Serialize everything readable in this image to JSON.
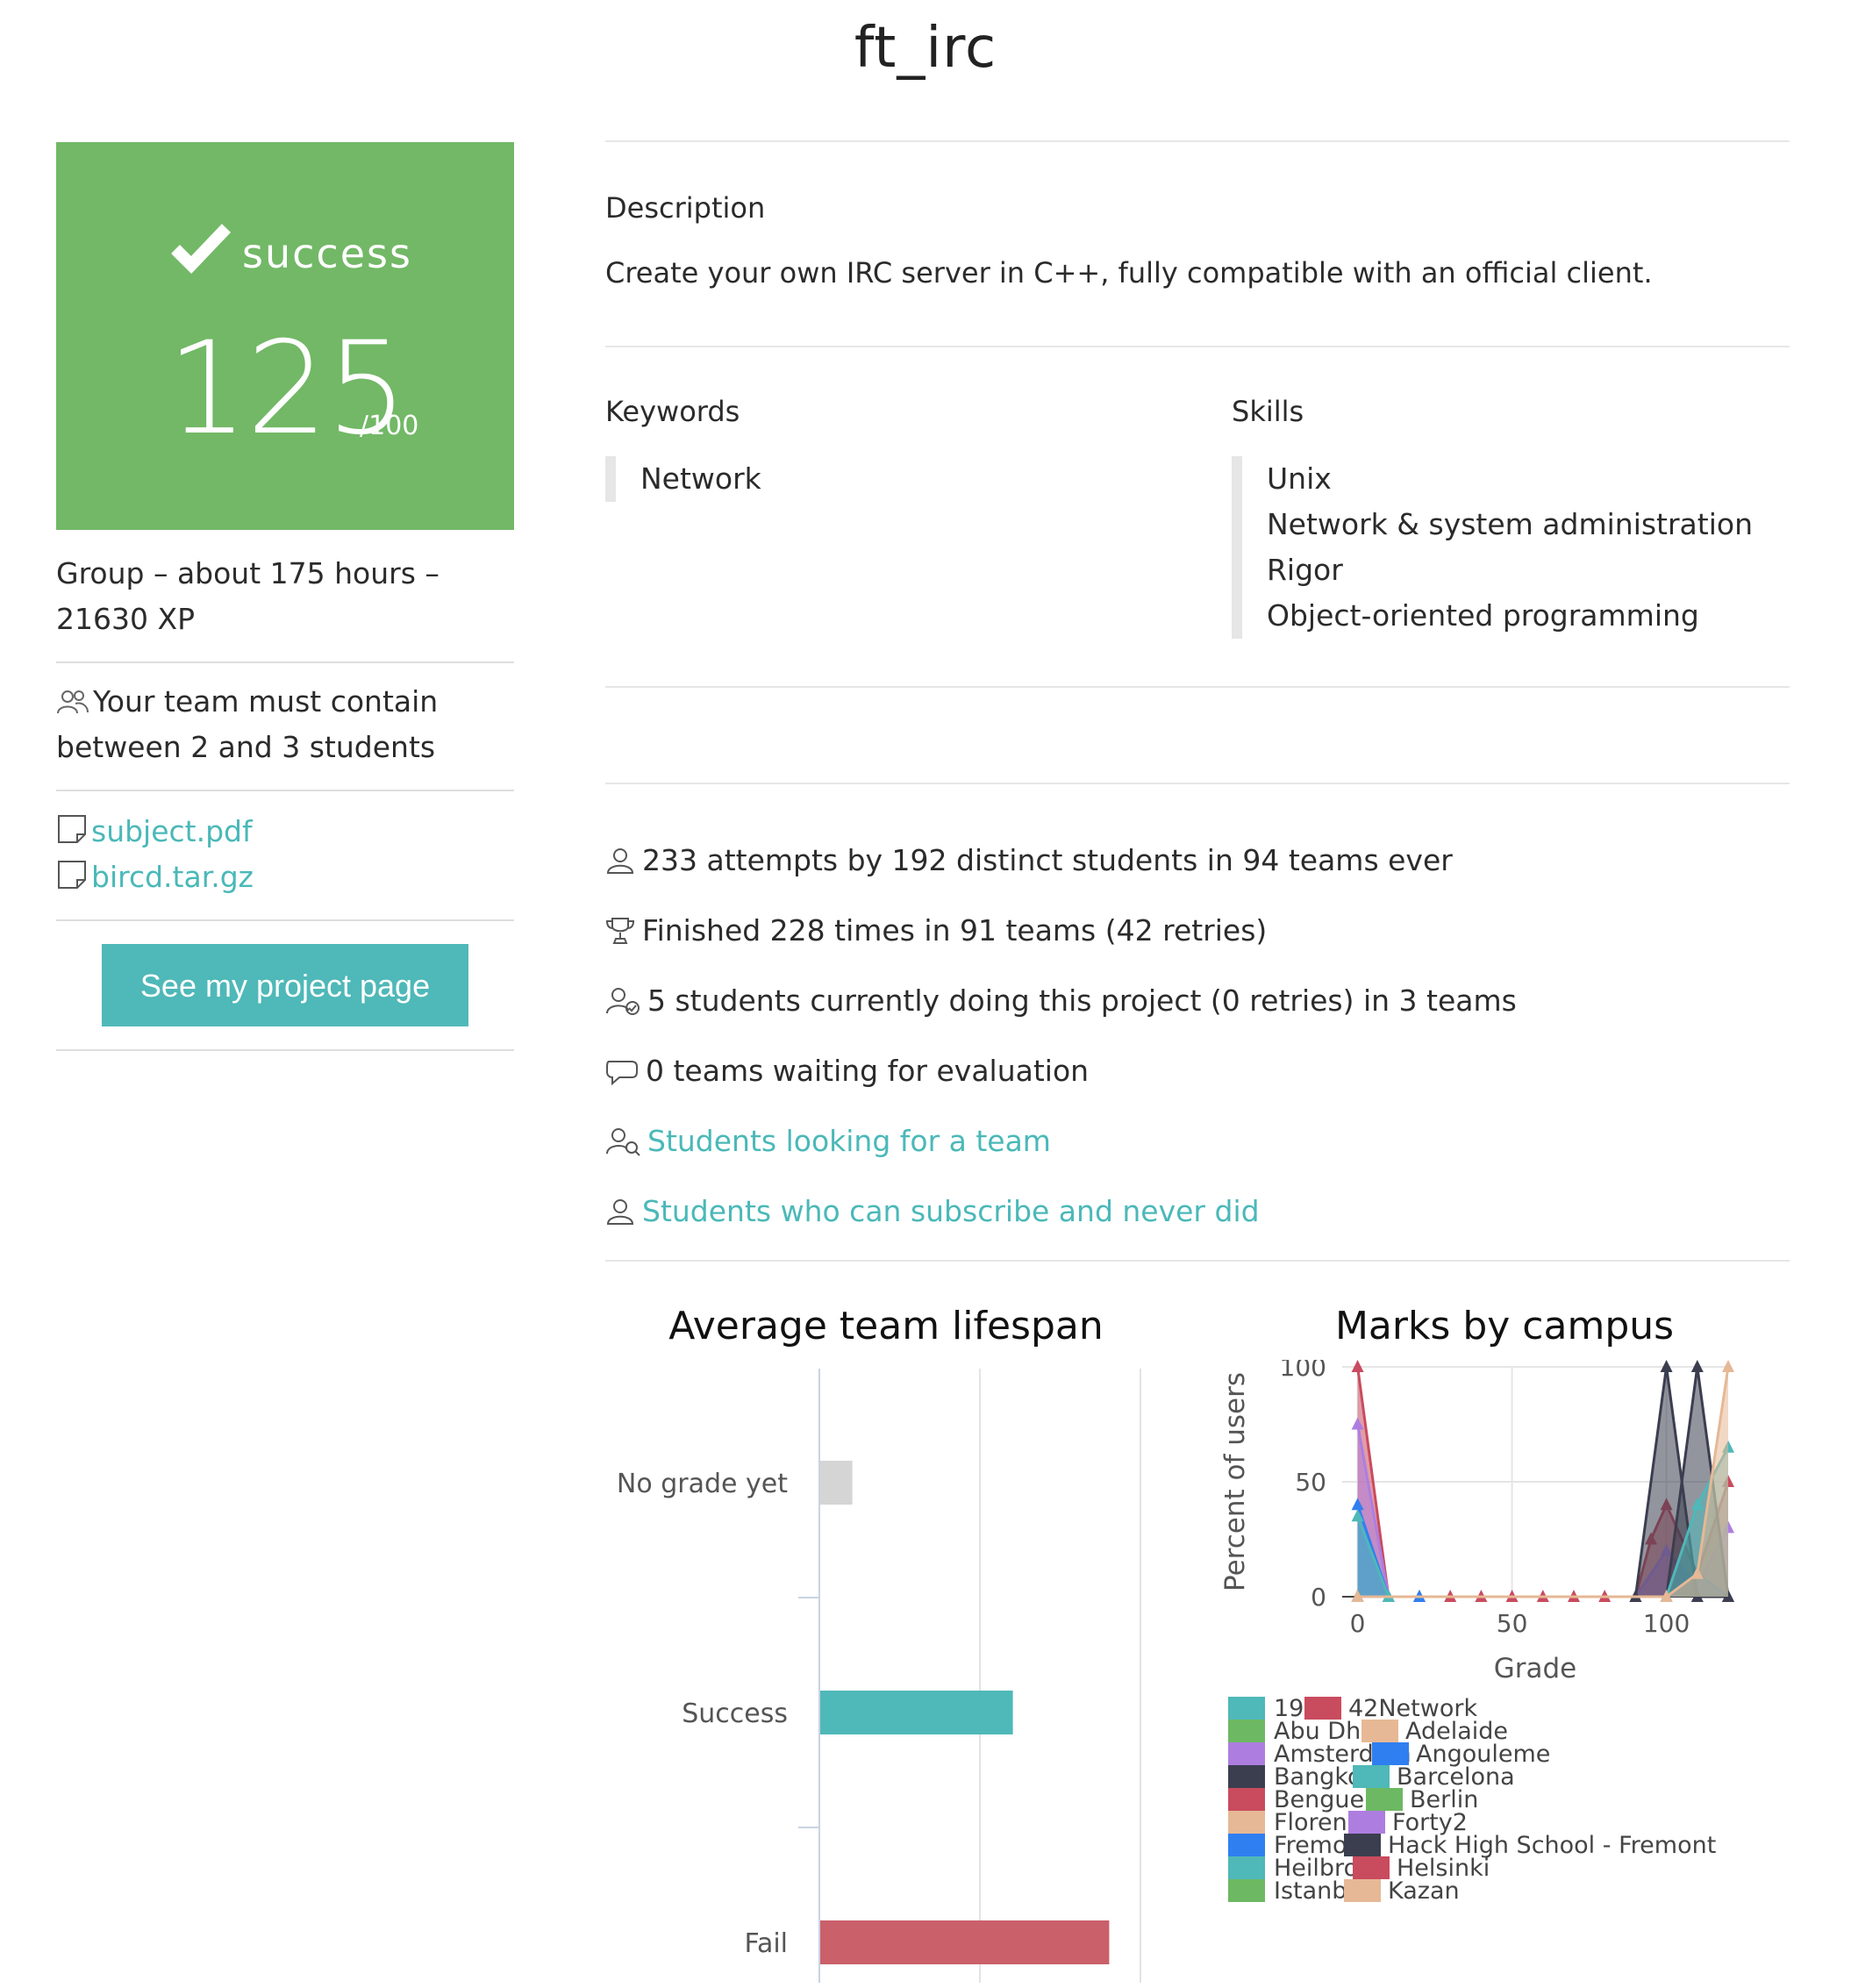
{
  "page": {
    "title": "ft_irc"
  },
  "mark": {
    "status": "success",
    "value": "125",
    "out_of": "/100"
  },
  "meta": {
    "info": "Group – about 175 hours – 21630 XP",
    "team_size": "Your team must contain between 2 and 3 students"
  },
  "attachments": [
    {
      "name": "subject.pdf"
    },
    {
      "name": "bircd.tar.gz"
    }
  ],
  "project_button": {
    "label": "See my project page"
  },
  "description": {
    "label": "Description",
    "text": "Create your own IRC server in C++, fully compatible with an official client."
  },
  "keywords": {
    "label": "Keywords",
    "items": [
      "Network"
    ]
  },
  "skills": {
    "label": "Skills",
    "items": [
      "Unix",
      "Network & system administration",
      "Rigor",
      "Object-oriented programming"
    ]
  },
  "stats": {
    "attempts": "233 attempts by 192 distinct students in 94 teams ever",
    "finished": "Finished 228 times in 91 teams (42 retries)",
    "current": "5 students currently doing this project (0 retries) in 3 teams",
    "waiting": "0 teams waiting for evaluation",
    "looking_link": "Students looking for a team",
    "never_link": "Students who can subscribe and never did"
  },
  "colors": {
    "success": "#72b866",
    "accent": "#4fb8b8",
    "fail": "#c9606a",
    "no_grade": "#d5d5d5"
  },
  "icons": [
    "check-icon",
    "team-icon",
    "file-icon",
    "user-icon",
    "trophy-icon",
    "user-check-icon",
    "chat-icon",
    "user-search-icon"
  ],
  "chart_data": [
    {
      "type": "bar",
      "title": "Average team lifespan",
      "orientation": "horizontal",
      "categories": [
        "No grade yet",
        "Success",
        "Fail"
      ],
      "values": [
        5,
        30,
        45
      ],
      "xlim": [
        0,
        50
      ],
      "grid": true,
      "colors": [
        "#d5d5d5",
        "#4fb8b8",
        "#c9606a"
      ]
    },
    {
      "type": "area",
      "title": "Marks by campus",
      "xlabel": "Grade",
      "ylabel": "Percent of users",
      "xlim": [
        -5,
        120
      ],
      "ylim": [
        0,
        100
      ],
      "xticks": [
        0,
        50,
        100
      ],
      "yticks": [
        0,
        50,
        100
      ],
      "grid": true,
      "legend_position": "bottom",
      "legend": [
        {
          "name": "19",
          "color": "#4fb8b8"
        },
        {
          "name": "42Network",
          "color": "#c94b5e"
        },
        {
          "name": "Abu Dhabi",
          "color": "#6db862"
        },
        {
          "name": "Adelaide",
          "color": "#e6b895"
        },
        {
          "name": "Amsterdam",
          "color": "#ad7ee0"
        },
        {
          "name": "Angouleme",
          "color": "#2f7ff0"
        },
        {
          "name": "Bangkok",
          "color": "#3b3e4f"
        },
        {
          "name": "Barcelona",
          "color": "#4fb8b8"
        },
        {
          "name": "Benguerir",
          "color": "#c94b5e"
        },
        {
          "name": "Berlin",
          "color": "#6db862"
        },
        {
          "name": "Florence",
          "color": "#e6b895"
        },
        {
          "name": "Forty2",
          "color": "#ad7ee0"
        },
        {
          "name": "Fremont",
          "color": "#2f7ff0"
        },
        {
          "name": "Hack High School - Fremont",
          "color": "#3b3e4f"
        },
        {
          "name": "Heilbronn",
          "color": "#4fb8b8"
        },
        {
          "name": "Helsinki",
          "color": "#c94b5e"
        },
        {
          "name": "Istanbul",
          "color": "#6db862"
        },
        {
          "name": "Kazan",
          "color": "#e6b895"
        }
      ],
      "series": [
        {
          "name": "42Network",
          "color": "#c94b5e",
          "x": [
            0,
            10,
            20,
            30,
            40,
            50,
            60,
            70,
            80,
            90,
            95,
            100,
            110,
            120
          ],
          "y": [
            100,
            0,
            0,
            0,
            0,
            0,
            0,
            0,
            0,
            0,
            25,
            40,
            10,
            50
          ]
        },
        {
          "name": "Amsterdam",
          "color": "#ad7ee0",
          "x": [
            0,
            10,
            20,
            90,
            100,
            110,
            120
          ],
          "y": [
            75,
            0,
            0,
            0,
            20,
            5,
            30
          ]
        },
        {
          "name": "Fremont",
          "color": "#2f7ff0",
          "x": [
            0,
            10,
            20,
            100,
            110,
            120
          ],
          "y": [
            40,
            0,
            0,
            0,
            10,
            0
          ]
        },
        {
          "name": "Bangkok",
          "color": "#3b3e4f",
          "x": [
            0,
            90,
            100,
            110,
            120
          ],
          "y": [
            0,
            0,
            100,
            0,
            0
          ]
        },
        {
          "name": "Hack High School - Fremont",
          "color": "#3b3e4f",
          "x": [
            0,
            100,
            110,
            120
          ],
          "y": [
            0,
            0,
            100,
            0
          ]
        },
        {
          "name": "Barcelona",
          "color": "#4fb8b8",
          "x": [
            0,
            10,
            100,
            110,
            120
          ],
          "y": [
            35,
            0,
            0,
            40,
            65
          ]
        },
        {
          "name": "Adelaide",
          "color": "#e6b895",
          "x": [
            0,
            100,
            110,
            120
          ],
          "y": [
            0,
            0,
            10,
            100
          ]
        }
      ]
    }
  ]
}
